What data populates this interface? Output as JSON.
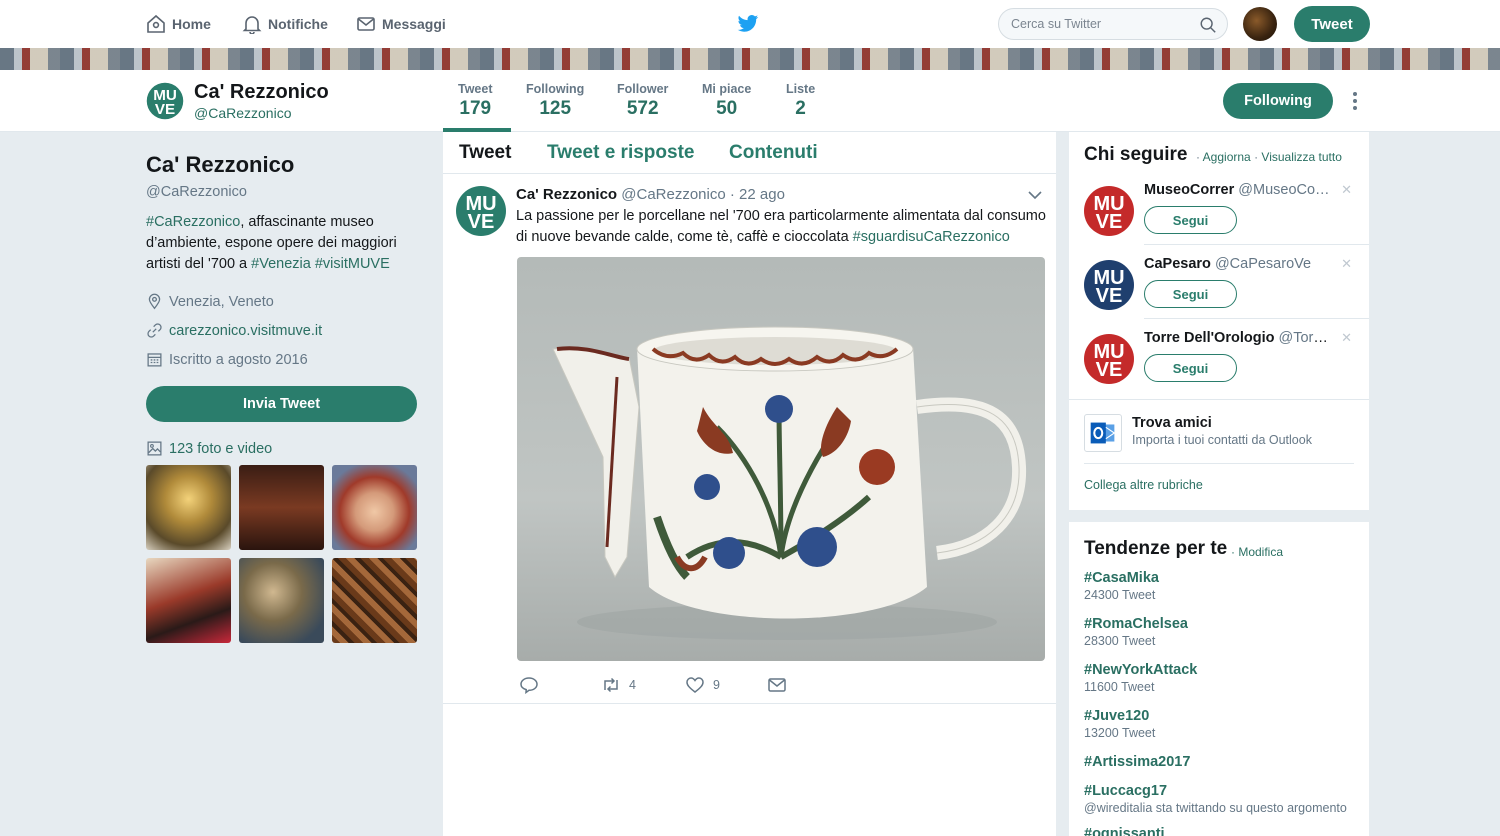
{
  "nav": {
    "home": "Home",
    "notifications": "Notifiche",
    "messages": "Messaggi",
    "search_placeholder": "Cerca su Twitter",
    "tweet_button": "Tweet"
  },
  "profile": {
    "name": "Ca' Rezzonico",
    "handle": "@CaRezzonico",
    "stats": [
      {
        "label": "Tweet",
        "value": "179"
      },
      {
        "label": "Following",
        "value": "125"
      },
      {
        "label": "Follower",
        "value": "572"
      },
      {
        "label": "Mi piace",
        "value": "50"
      },
      {
        "label": "Liste",
        "value": "2"
      }
    ],
    "following_button": "Following",
    "bio": {
      "hashtag1": "#CaRezzonico",
      "text1": ", affascinante museo d’ambiente, espone opere dei maggiori artisti del '700 a ",
      "hashtag2": "#Venezia",
      "space": " ",
      "hashtag3": "#visitMUVE"
    },
    "location": "Venezia, Veneto",
    "website": "carezzonico.visitmuve.it",
    "joined": "Iscritto a agosto 2016",
    "send_tweet_button": "Invia Tweet",
    "photos_label": "123 foto e video"
  },
  "timeline": {
    "tabs": [
      "Tweet",
      "Tweet e risposte",
      "Contenuti"
    ],
    "tweet": {
      "author": "Ca' Rezzonico",
      "handle": "@CaRezzonico",
      "time": "· 22 ago",
      "text": "La passione per le porcellane nel '700 era particolarmente alimentata dal consumo di nuove bevande calde, come tè, caffè e cioccolata ",
      "hashtag": "#sguardisuCaRezzonico",
      "retweets": "4",
      "likes": "9"
    }
  },
  "who_to_follow": {
    "title": "Chi seguire",
    "refresh": "Aggiorna",
    "dot": "·",
    "view_all": "Visualizza tutto",
    "suggestions": [
      {
        "name": "MuseoCorrer",
        "handle": "@MuseoCo…",
        "button": "Segui"
      },
      {
        "name": "CaPesaro",
        "handle": "@CaPesaroVe",
        "button": "Segui"
      },
      {
        "name": "Torre Dell'Orologio",
        "handle": "@Torr…",
        "button": "Segui"
      }
    ],
    "find_friends_title": "Trova amici",
    "find_friends_sub": "Importa i tuoi contatti da Outlook",
    "connect_more": "Collega altre rubriche"
  },
  "trends": {
    "title": "Tendenze per te",
    "edit": "· Modifica",
    "items": [
      {
        "name": "#CasaMika",
        "count": "24300 Tweet"
      },
      {
        "name": "#RomaChelsea",
        "count": "28300 Tweet"
      },
      {
        "name": "#NewYorkAttack",
        "count": "11600 Tweet"
      },
      {
        "name": "#Juve120",
        "count": "13200 Tweet"
      },
      {
        "name": "#Artissima2017",
        "count": ""
      },
      {
        "name": "#Luccacg17",
        "count": "@wireditalia sta twittando su questo argomento"
      },
      {
        "name": "#ognissanti",
        "count": ""
      }
    ]
  },
  "colors": {
    "accent": "#2a7d6c",
    "link": "#2a6f62",
    "bg": "#e6ecf0",
    "twitter_blue": "#1da1f2",
    "muve_green": "#2a7d6c",
    "muve_red": "#c42a2a"
  }
}
